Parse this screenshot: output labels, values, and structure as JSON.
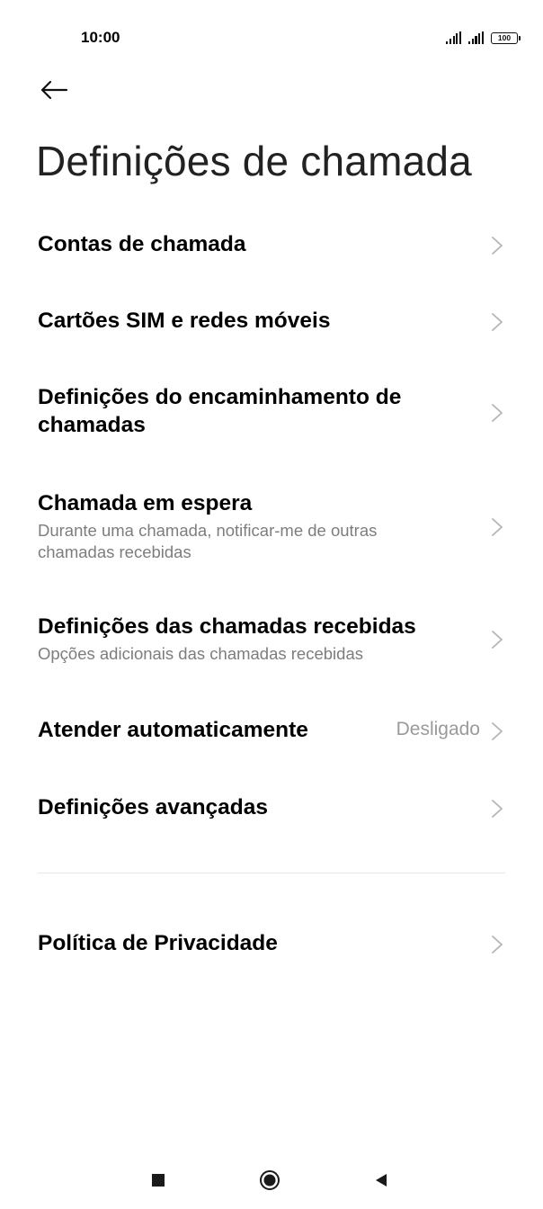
{
  "status_bar": {
    "time": "10:00",
    "battery_level": "100",
    "signal_icon": "signal-icon",
    "battery_icon": "battery-icon"
  },
  "header": {
    "back_icon": "back-arrow-icon",
    "title": "Definições de chamada"
  },
  "settings": [
    {
      "label": "Contas de chamada",
      "summary": "",
      "value": ""
    },
    {
      "label": "Cartões SIM e redes móveis",
      "summary": "",
      "value": ""
    },
    {
      "label": "Definições do encaminhamento de chamadas",
      "summary": "",
      "value": ""
    },
    {
      "label": "Chamada em espera",
      "summary": "Durante uma chamada, notificar-me de outras chamadas recebidas",
      "value": ""
    },
    {
      "label": "Definições das chamadas recebidas",
      "summary": "Opções adicionais das chamadas recebidas",
      "value": ""
    },
    {
      "label": "Atender automaticamente",
      "summary": "",
      "value": "Desligado"
    },
    {
      "label": "Definições avançadas",
      "summary": "",
      "value": ""
    }
  ],
  "privacy": {
    "label": "Política de Privacidade"
  },
  "nav_bar": {
    "recents_icon": "square-icon",
    "home_icon": "circle-icon",
    "back_icon": "triangle-back-icon"
  },
  "colors": {
    "text_primary": "#000000",
    "text_secondary": "#7d7d7d",
    "value_text": "#9a9a9a",
    "chevron": "#b5b5b5",
    "divider": "#e6e6e6"
  }
}
